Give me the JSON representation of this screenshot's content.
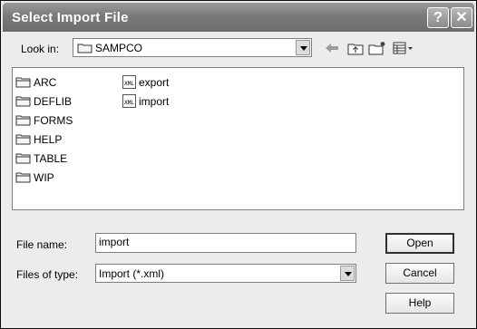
{
  "window": {
    "title": "Select Import File",
    "help_glyph": "?",
    "close_glyph": "✕"
  },
  "lookin": {
    "label": "Look in:",
    "value": "SAMPCO"
  },
  "toolbar": [
    "back-icon",
    "up-folder-icon",
    "new-folder-icon",
    "view-menu-icon"
  ],
  "files": [
    {
      "name": "ARC",
      "type": "folder"
    },
    {
      "name": "DEFLIB",
      "type": "folder"
    },
    {
      "name": "FORMS",
      "type": "folder"
    },
    {
      "name": "HELP",
      "type": "folder"
    },
    {
      "name": "TABLE",
      "type": "folder"
    },
    {
      "name": "WIP",
      "type": "folder"
    },
    {
      "name": "export",
      "type": "xml"
    },
    {
      "name": "import",
      "type": "xml"
    }
  ],
  "filename": {
    "label": "File name:",
    "value": "import"
  },
  "filetype": {
    "label": "Files of type:",
    "value": "Import (*.xml)"
  },
  "buttons": {
    "open": "Open",
    "cancel": "Cancel",
    "help": "Help"
  },
  "xml_icon_text": "XML"
}
